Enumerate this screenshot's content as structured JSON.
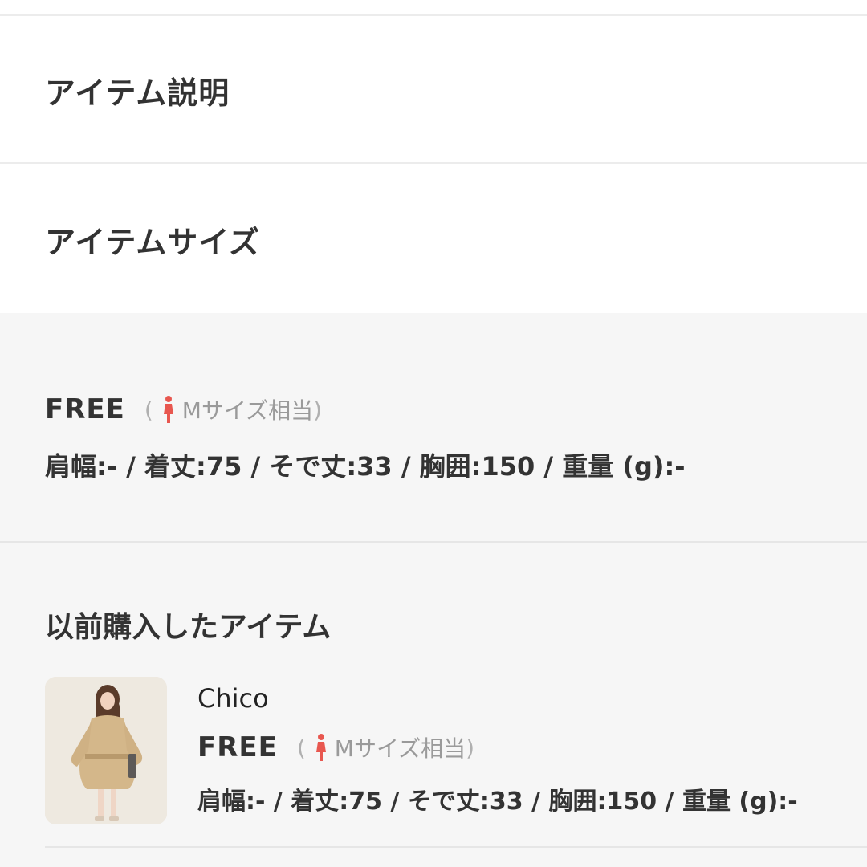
{
  "sections": {
    "description_title": "アイテム説明",
    "size_title": "アイテムサイズ"
  },
  "size_entry": {
    "size_label": "FREE",
    "paren_open": "(",
    "equivalent": "Mサイズ相当",
    "paren_close": ")",
    "measurements": "肩幅:- / 着丈:75 / そで丈:33 / 胸囲:150 / 重量 (g):-"
  },
  "previous": {
    "title": "以前購入したアイテム",
    "item": {
      "brand": "Chico",
      "size_label": "FREE",
      "paren_open": "(",
      "equivalent": "Mサイズ相当",
      "paren_close": ")",
      "measurements": "肩幅:- / 着丈:75 / そで丈:33 / 胸囲:150 / 重量 (g):-"
    }
  },
  "icons": {
    "woman": "woman-icon"
  },
  "colors": {
    "text": "#333333",
    "muted": "#9a9a9a",
    "panel_bg": "#f6f6f6",
    "icon_accent": "#e8574f"
  }
}
